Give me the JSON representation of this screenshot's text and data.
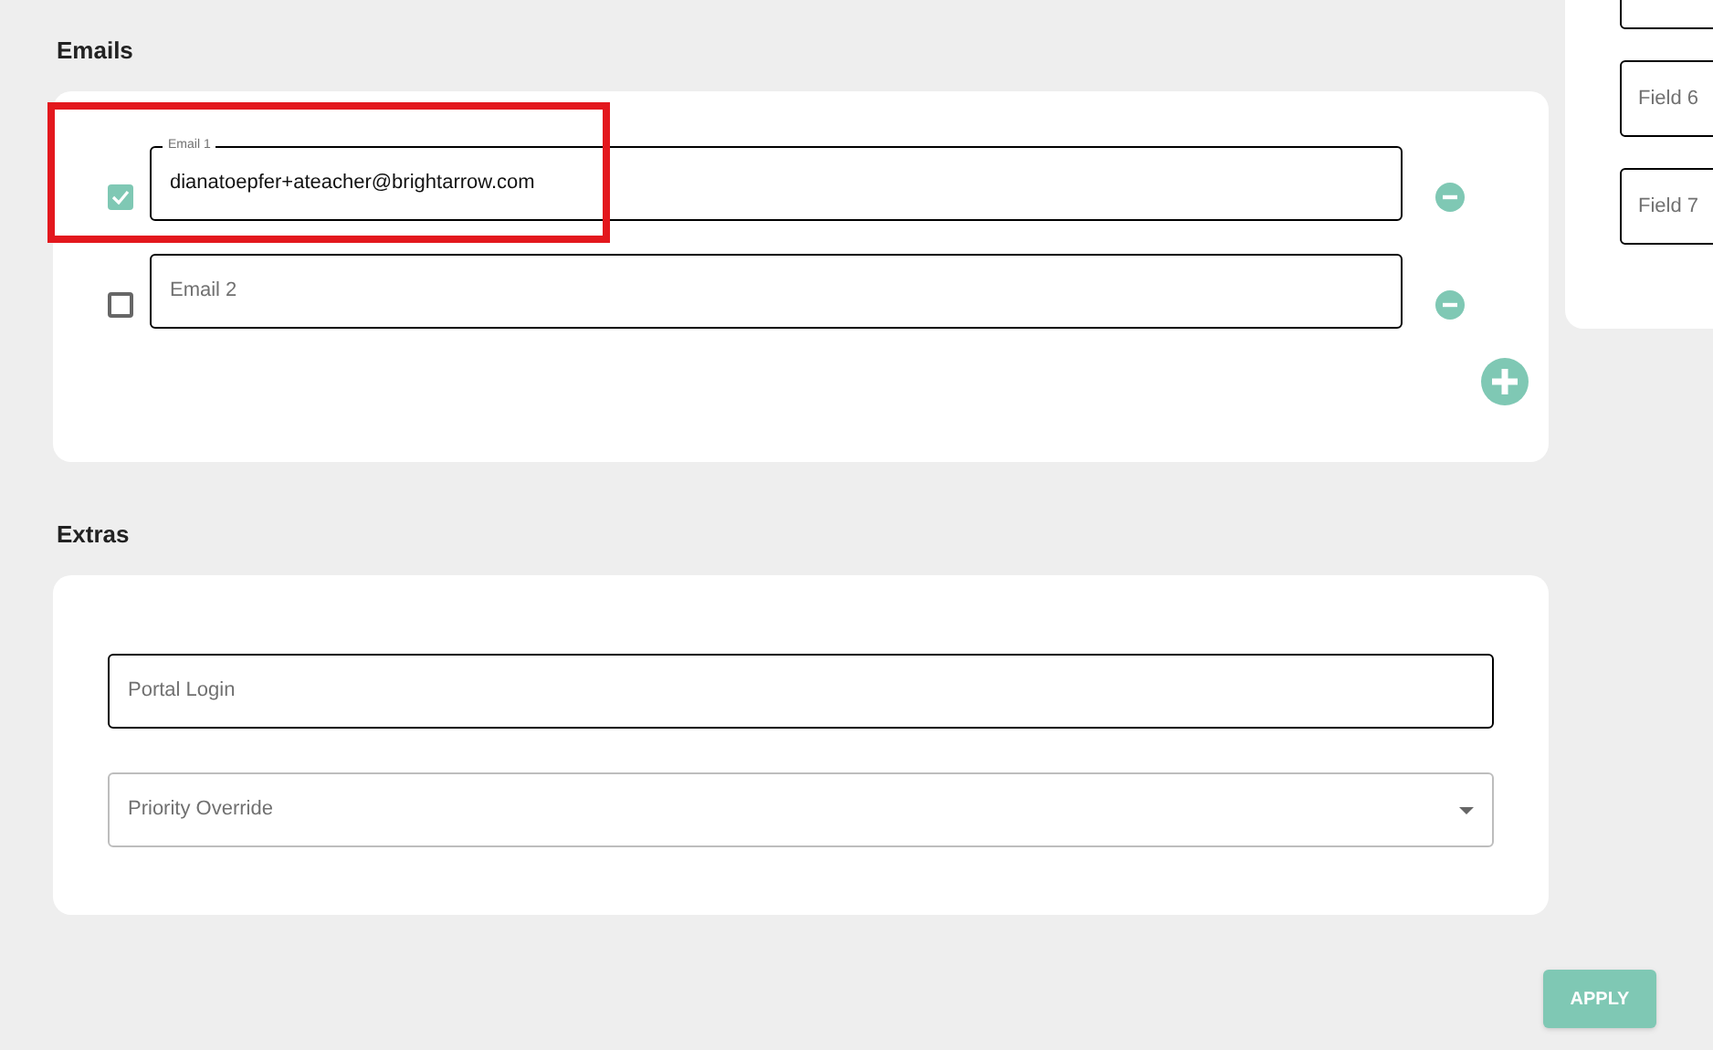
{
  "emails": {
    "heading": "Emails",
    "items": [
      {
        "label": "Email 1",
        "value": "dianatoepfer+ateacher@brightarrow.com",
        "checked": true
      },
      {
        "placeholder": "Email 2",
        "checked": false
      }
    ]
  },
  "extras": {
    "heading": "Extras",
    "portal_login": {
      "placeholder": "Portal Login"
    },
    "priority_override": {
      "placeholder": "Priority Override"
    }
  },
  "side_fields": [
    {
      "placeholder": "Field 6"
    },
    {
      "placeholder": "Field 7"
    }
  ],
  "apply_button": {
    "label": "APPLY"
  }
}
